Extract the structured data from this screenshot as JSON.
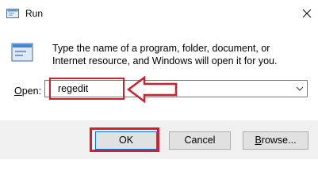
{
  "window": {
    "title": "Run",
    "icon": "run-icon",
    "close_glyph": "✕"
  },
  "dialog": {
    "description": "Type the name of a program, folder, document, or Internet resource, and Windows will open it for you.",
    "open_label_underlined": "O",
    "open_label_rest": "pen:",
    "open_value": "regedit"
  },
  "buttons": {
    "ok": "OK",
    "cancel": "Cancel",
    "browse_underlined": "B",
    "browse_rest": "rowse..."
  },
  "annotations": {
    "highlight_color": "#d21f2b",
    "arrow_icon": "left-arrow-icon"
  }
}
